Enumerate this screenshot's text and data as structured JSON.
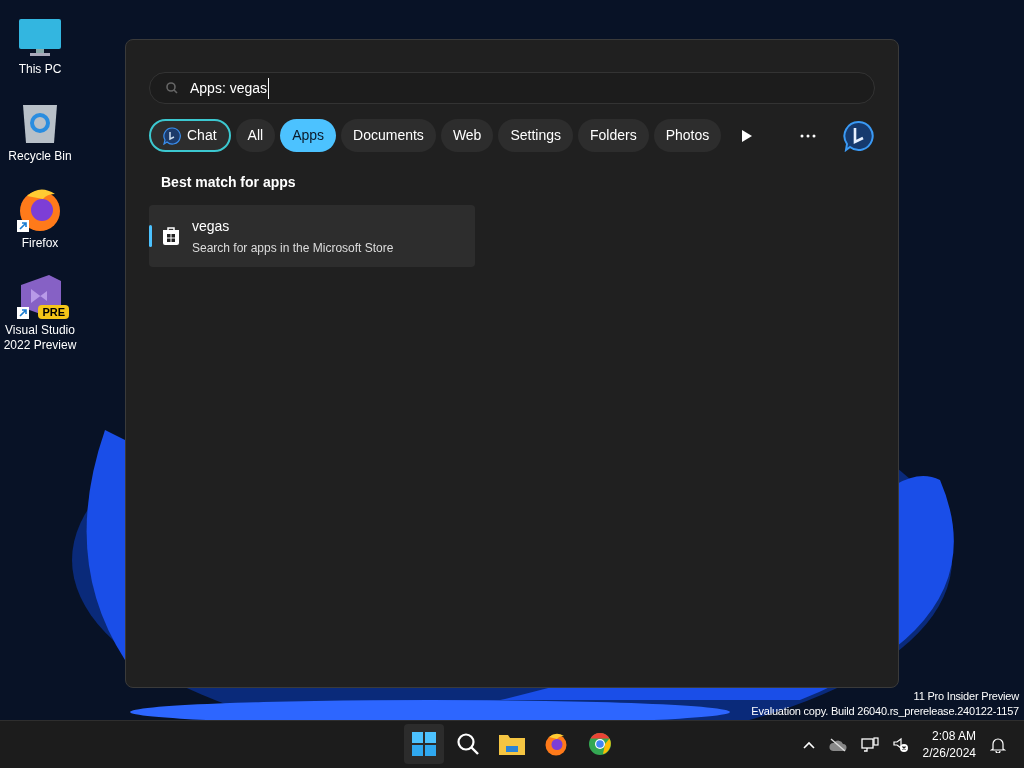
{
  "desktop_icons": [
    {
      "kind": "pc",
      "label": "This PC"
    },
    {
      "kind": "bin",
      "label": "Recycle Bin"
    },
    {
      "kind": "firefox",
      "label": "Firefox",
      "shortcut": true
    },
    {
      "kind": "vs",
      "label": "Visual Studio 2022 Preview",
      "shortcut": true,
      "badge": "PRE"
    }
  ],
  "search": {
    "value": "Apps: vegas"
  },
  "filters": [
    {
      "kind": "chat",
      "label": "Chat",
      "selected": false
    },
    {
      "kind": "text",
      "label": "All",
      "selected": false
    },
    {
      "kind": "text",
      "label": "Apps",
      "selected": true
    },
    {
      "kind": "text",
      "label": "Documents",
      "selected": false
    },
    {
      "kind": "text",
      "label": "Web",
      "selected": false
    },
    {
      "kind": "text",
      "label": "Settings",
      "selected": false
    },
    {
      "kind": "text",
      "label": "Folders",
      "selected": false
    },
    {
      "kind": "text",
      "label": "Photos",
      "selected": false
    }
  ],
  "section_title": "Best match for apps",
  "results": [
    {
      "title": "vegas",
      "subtitle": "Search for apps in the Microsoft Store",
      "selected": true
    }
  ],
  "watermark": [
    "11 Pro Insider Preview",
    "Evaluation copy. Build 26040.rs_prerelease.240122-1157"
  ],
  "taskbar": {
    "apps": [
      {
        "kind": "start",
        "selected": true
      },
      {
        "kind": "search",
        "selected": false
      },
      {
        "kind": "explorer",
        "selected": false
      },
      {
        "kind": "firefox",
        "selected": false
      },
      {
        "kind": "chrome",
        "selected": false
      }
    ],
    "time": "2:08 AM",
    "date": "2/26/2024"
  }
}
